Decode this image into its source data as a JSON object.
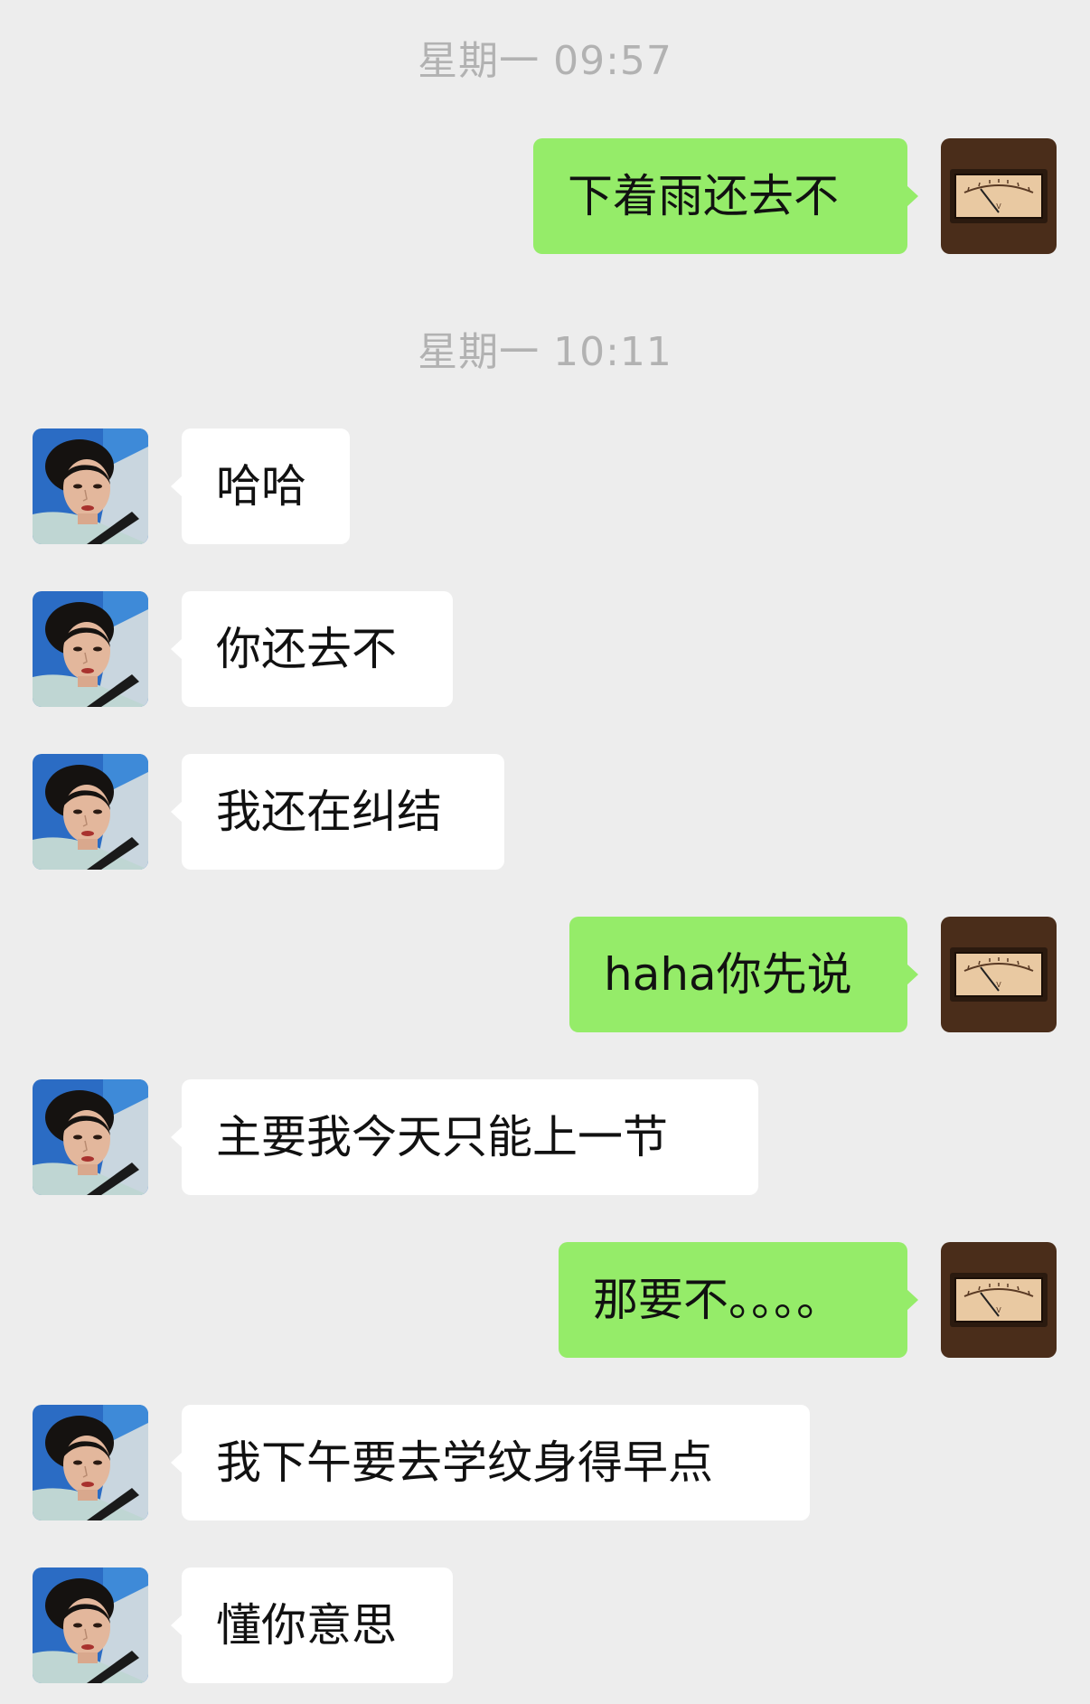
{
  "chat": {
    "timestamps": [
      "星期一 09:57",
      "星期一 10:11"
    ],
    "messages": [
      {
        "from": "me",
        "text": "下着雨还去不"
      },
      {
        "from": "other",
        "text": "哈哈"
      },
      {
        "from": "other",
        "text": "你还去不"
      },
      {
        "from": "other",
        "text": "我还在纠结"
      },
      {
        "from": "me",
        "text": "haha你先说"
      },
      {
        "from": "other",
        "text": "主要我今天只能上一节"
      },
      {
        "from": "me",
        "text": "那要不。。。。"
      },
      {
        "from": "other",
        "text": "我下午要去学纹身得早点"
      },
      {
        "from": "other",
        "text": "懂你意思"
      }
    ]
  },
  "avatars": {
    "me": "vu-meter-icon",
    "other": "portrait-avatar"
  },
  "colors": {
    "background": "#ededed",
    "sent_bubble": "#95ec69",
    "received_bubble": "#ffffff",
    "timestamp_text": "#b2b2b2"
  }
}
